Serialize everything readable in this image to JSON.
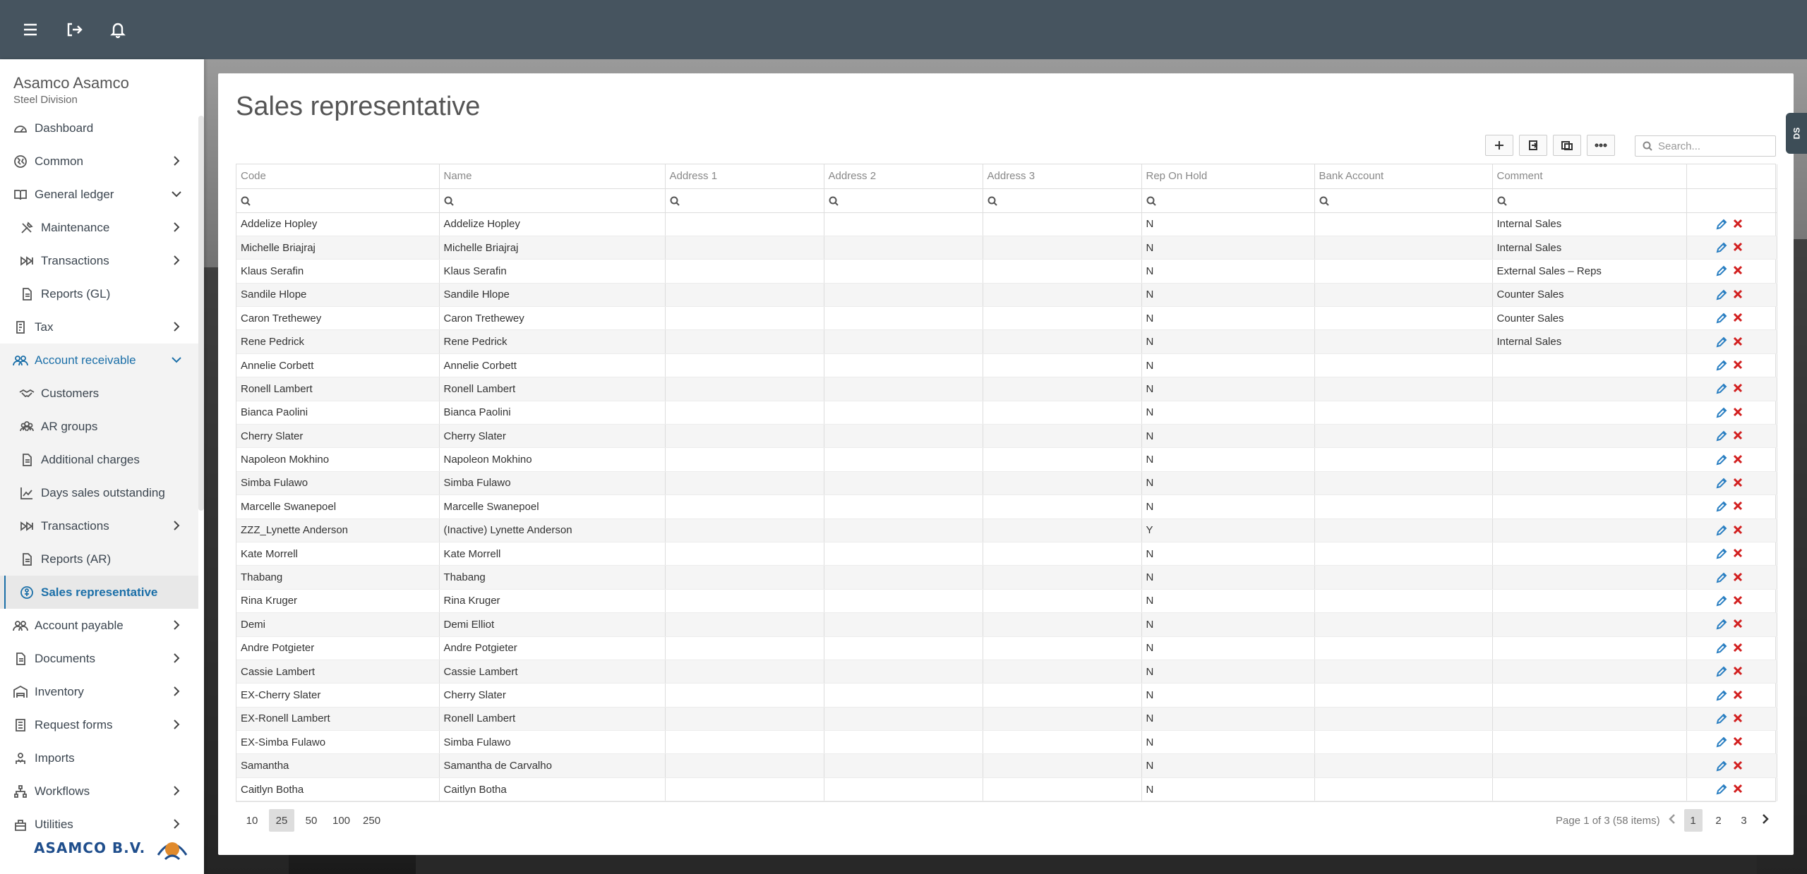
{
  "topbar": {
    "icons": [
      "menu-icon",
      "logout-icon",
      "bell-icon"
    ]
  },
  "company": {
    "name": "Asamco Asamco",
    "division": "Steel Division"
  },
  "sidebar": {
    "items": [
      {
        "label": "Dashboard",
        "icon": "dashboard-icon"
      },
      {
        "label": "Common",
        "icon": "globe-icon"
      },
      {
        "label": "General ledger",
        "icon": "book-icon"
      },
      {
        "label": "Maintenance",
        "icon": "tools-icon"
      },
      {
        "label": "Transactions",
        "icon": "fast-forward-icon"
      },
      {
        "label": "Reports (GL)",
        "icon": "report-icon"
      },
      {
        "label": "Tax",
        "icon": "tax-icon"
      },
      {
        "label": "Account receivable",
        "icon": "users-icon"
      },
      {
        "label": "Customers",
        "icon": "handshake-icon"
      },
      {
        "label": "AR groups",
        "icon": "group-icon"
      },
      {
        "label": "Additional charges",
        "icon": "document-icon"
      },
      {
        "label": "Days sales outstanding",
        "icon": "chart-line-icon"
      },
      {
        "label": "Transactions",
        "icon": "fast-forward-icon"
      },
      {
        "label": "Reports (AR)",
        "icon": "report-icon"
      },
      {
        "label": "Sales representative",
        "icon": "rep-icon"
      },
      {
        "label": "Account payable",
        "icon": "users-icon"
      },
      {
        "label": "Documents",
        "icon": "document-icon"
      },
      {
        "label": "Inventory",
        "icon": "warehouse-icon"
      },
      {
        "label": "Request forms",
        "icon": "form-icon"
      },
      {
        "label": "Imports",
        "icon": "import-icon"
      },
      {
        "label": "Workflows",
        "icon": "workflow-icon"
      },
      {
        "label": "Utilities",
        "icon": "utilities-icon"
      }
    ]
  },
  "logo": {
    "text": "ASAMCO B.V."
  },
  "page": {
    "title": "Sales representative"
  },
  "search": {
    "placeholder": "Search..."
  },
  "table": {
    "columns": [
      "Code",
      "Name",
      "Address 1",
      "Address 2",
      "Address 3",
      "Rep On Hold",
      "Bank Account",
      "Comment",
      ""
    ],
    "rows": [
      [
        "Addelize Hopley",
        "Addelize Hopley",
        "",
        "",
        "",
        "N",
        "",
        "Internal Sales"
      ],
      [
        "Michelle Briajraj",
        "Michelle Briajraj",
        "",
        "",
        "",
        "N",
        "",
        "Internal Sales"
      ],
      [
        "Klaus Serafin",
        "Klaus Serafin",
        "",
        "",
        "",
        "N",
        "",
        "External Sales – Reps"
      ],
      [
        "Sandile Hlope",
        "Sandile Hlope",
        "",
        "",
        "",
        "N",
        "",
        "Counter Sales"
      ],
      [
        "Caron Trethewey",
        "Caron Trethewey",
        "",
        "",
        "",
        "N",
        "",
        "Counter Sales"
      ],
      [
        "Rene Pedrick",
        "Rene Pedrick",
        "",
        "",
        "",
        "N",
        "",
        "Internal Sales"
      ],
      [
        "Annelie Corbett",
        "Annelie Corbett",
        "",
        "",
        "",
        "N",
        "",
        ""
      ],
      [
        "Ronell Lambert",
        "Ronell Lambert",
        "",
        "",
        "",
        "N",
        "",
        ""
      ],
      [
        "Bianca Paolini",
        "Bianca Paolini",
        "",
        "",
        "",
        "N",
        "",
        ""
      ],
      [
        "Cherry Slater",
        "Cherry Slater",
        "",
        "",
        "",
        "N",
        "",
        ""
      ],
      [
        "Napoleon Mokhino",
        "Napoleon Mokhino",
        "",
        "",
        "",
        "N",
        "",
        ""
      ],
      [
        "Simba Fulawo",
        "Simba Fulawo",
        "",
        "",
        "",
        "N",
        "",
        ""
      ],
      [
        "Marcelle Swanepoel",
        "Marcelle Swanepoel",
        "",
        "",
        "",
        "N",
        "",
        ""
      ],
      [
        "ZZZ_Lynette Anderson",
        "(Inactive) Lynette Anderson",
        "",
        "",
        "",
        "Y",
        "",
        ""
      ],
      [
        "Kate Morrell",
        "Kate Morrell",
        "",
        "",
        "",
        "N",
        "",
        ""
      ],
      [
        "Thabang",
        "Thabang",
        "",
        "",
        "",
        "N",
        "",
        ""
      ],
      [
        "Rina Kruger",
        "Rina Kruger",
        "",
        "",
        "",
        "N",
        "",
        ""
      ],
      [
        "Demi",
        "Demi Elliot",
        "",
        "",
        "",
        "N",
        "",
        ""
      ],
      [
        "Andre Potgieter",
        "Andre Potgieter",
        "",
        "",
        "",
        "N",
        "",
        ""
      ],
      [
        "Cassie Lambert",
        "Cassie Lambert",
        "",
        "",
        "",
        "N",
        "",
        ""
      ],
      [
        "EX-Cherry Slater",
        "Cherry Slater",
        "",
        "",
        "",
        "N",
        "",
        ""
      ],
      [
        "EX-Ronell Lambert",
        "Ronell Lambert",
        "",
        "",
        "",
        "N",
        "",
        ""
      ],
      [
        "EX-Simba Fulawo",
        "Simba Fulawo",
        "",
        "",
        "",
        "N",
        "",
        ""
      ],
      [
        "Samantha",
        "Samantha de Carvalho",
        "",
        "",
        "",
        "N",
        "",
        ""
      ],
      [
        "Caitlyn Botha",
        "Caitlyn Botha",
        "",
        "",
        "",
        "N",
        "",
        ""
      ]
    ]
  },
  "pager": {
    "sizes": [
      "10",
      "25",
      "50",
      "100",
      "250"
    ],
    "selected_size": "25",
    "info": "Page 1 of 3 (58 items)",
    "pages": [
      "1",
      "2",
      "3"
    ],
    "current_page": "1"
  },
  "ds_tab": {
    "label": "DS"
  }
}
